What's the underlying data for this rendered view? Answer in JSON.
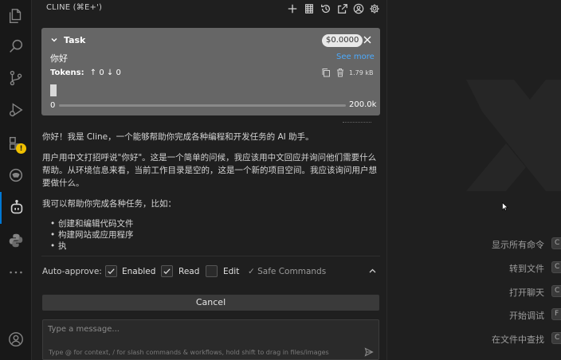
{
  "sidebar": {
    "title": "CLINE (⌘E+')"
  },
  "task": {
    "label": "Task",
    "cost": "$0.0000",
    "text": "你好",
    "see_more": "See more",
    "tokens_label": "Tokens:",
    "tokens_in": "↑ 0",
    "tokens_out": "↓ 0",
    "size": "1.79 kB",
    "context_min": "0",
    "context_max": "200.0k"
  },
  "message": {
    "p1": "你好！我是 Cline，一个能够帮助你完成各种编程和开发任务的 AI 助手。",
    "p2": "用户用中文打招呼说\"你好\"。这是一个简单的问候，我应该用中文回应并询问他们需要什么帮助。从环境信息来看，当前工作目录是空的，这是一个新的项目空间。我应该询问用户想要做什么。",
    "p3": "我可以帮助你完成各种任务，比如：",
    "bullets": [
      "创建和编辑代码文件",
      "构建网站或应用程序",
      "执"
    ]
  },
  "auto_approve": {
    "label": "Auto-approve:",
    "enabled": "Enabled",
    "read": "Read",
    "edit": "Edit",
    "safe": "✓ Safe Commands"
  },
  "cancel_label": "Cancel",
  "input": {
    "placeholder": "Type a message...",
    "hint": "Type @ for context, / for slash commands & workflows, hold shift to drag in files/images"
  },
  "editor": {
    "commands": [
      {
        "label": "显示所有命令",
        "key": "C"
      },
      {
        "label": "转到文件",
        "key": "C"
      },
      {
        "label": "打开聊天",
        "key": "C"
      },
      {
        "label": "开始调试",
        "key": "F"
      },
      {
        "label": "在文件中查找",
        "key": "C"
      }
    ]
  }
}
